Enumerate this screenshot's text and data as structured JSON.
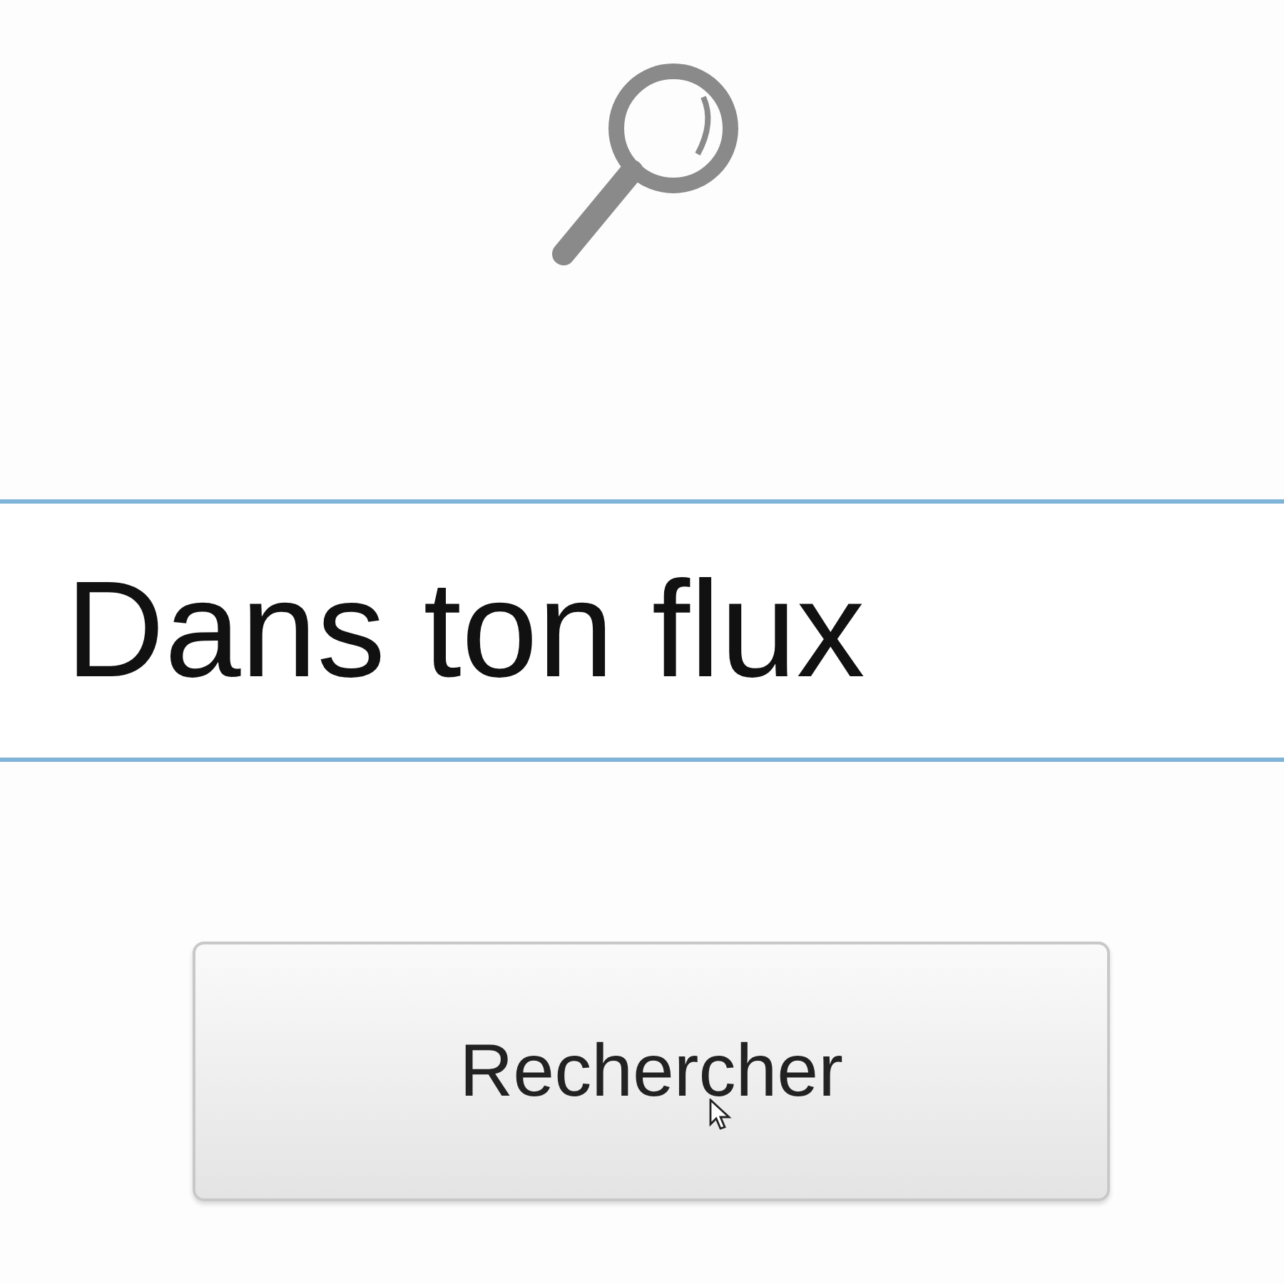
{
  "search_field": {
    "value": "Dans ton flux"
  },
  "search_button": {
    "label": "Rechercher"
  }
}
